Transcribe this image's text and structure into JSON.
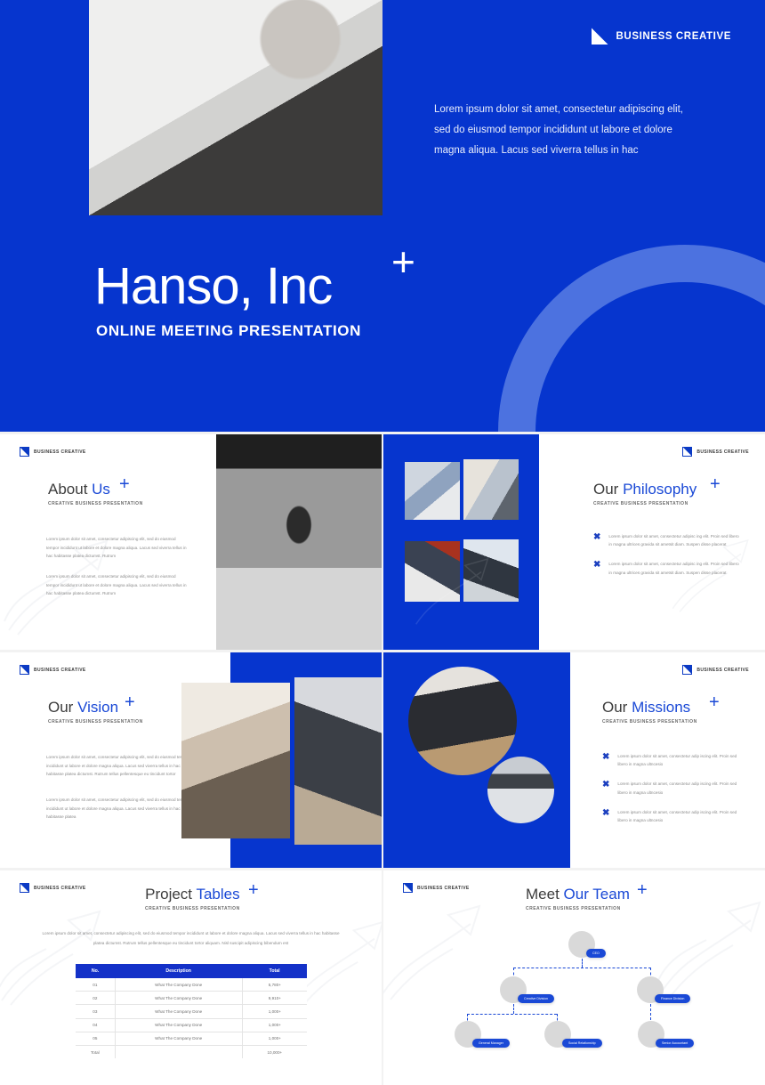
{
  "brand": {
    "name": "BUSINESS CREATIVE",
    "logo_icon": "diagonal-square-logo-icon",
    "primary_color": "#0635CE",
    "accent_color": "#1A49D6",
    "ring_color": "#4C72E0"
  },
  "hero": {
    "title": "Hanso, Inc",
    "subtitle": "ONLINE MEETING PRESENTATION",
    "paragraph": "Lorem ipsum dolor sit amet, consectetur adipiscing elit, sed do eiusmod tempor incididunt ut labore et dolore magna aliqua. Lacus sed viverra tellus in hac",
    "plus_icon": "+",
    "photo_alt": "desk-laptop-topdown-photo"
  },
  "kicker": "CREATIVE BUSINESS PRESENTATION",
  "slides": {
    "about": {
      "title_light": "About ",
      "title_bold": "Us",
      "kicker": "CREATIVE BUSINESS PRESENTATION",
      "plus_icon": "+",
      "paragraphs": [
        "Lorem ipsum dolor sit amet, consectetur adipiscing elit, sed do eiusmod tempor incididunt ut labore et dolore magna aliqua. Lacus sed viverra tellus in hac habitasse platea dictumst. Rutrum",
        "Lorem ipsum dolor sit amet, consectetur adipiscing elit, sed do eiusmod tempor incididunt ut labore et dolore magna aliqua. Lacus sed viverra tellus in hac habitasse platea dictumst. Rutrum"
      ],
      "photo_alt": "subway-station-woman-bw-photo"
    },
    "philosophy": {
      "title_light": "Our ",
      "title_bold": "Philosophy",
      "kicker": "CREATIVE BUSINESS PRESENTATION",
      "plus_icon": "+",
      "bullet_icon": "✖",
      "bullets": [
        "Lorem ipsum dolor sit amet, consectetur adipisc ing elit. Proin sed libero in magna ultrices gravida sit ametsit diam. Suspen disse placerat",
        "Lorem ipsum dolor sit amet, consectetur adipisc ing elit. Proin sed libero in magna ultrices gravida sit ametsit diam. Suspen disse placerat"
      ],
      "photos": [
        "office-window-laptop-photo",
        "hands-writing-notebook-photo",
        "businessman-presenting-photo",
        "hands-typing-chart-laptop-photo"
      ]
    },
    "vision": {
      "title_light": "Our ",
      "title_bold": "Vision",
      "kicker": "CREATIVE BUSINESS PRESENTATION",
      "plus_icon": "+",
      "paragraphs": [
        "Lorem ipsum dolor sit amet, consectetur adipiscing elit, sed do eiusmod tempor incididunt ut labore et dolore magna aliqua. Lacus sed viverra tellus in hac habitasse platea dictumst. Rutrum tellus pellentesque eu tincidunt tortor",
        "Lorem ipsum dolor sit amet, consectetur adipiscing elit, sed do eiusmod tempor incididunt ut labore et dolore magna aliqua. Lacus sed viverra tellus in hac habitasse platea"
      ],
      "photos": [
        "office-shelf-imac-photo",
        "developer-at-desk-photo"
      ]
    },
    "missions": {
      "title_light": "Our ",
      "title_bold": "Missions",
      "kicker": "CREATIVE BUSINESS PRESENTATION",
      "plus_icon": "+",
      "bullet_icon": "✖",
      "bullets": [
        "Lorem ipsum dolor sit amet, consectetur adip iscing elit. Proin sed libero in magna ultncesio",
        "Lorem ipsum dolor sit amet, consectetur adip iscing elit. Proin sed libero in magna ultncesio",
        "Lorem ipsum dolor sit amet, consectetur adip iscing elit. Proin sed libero in magna ultncesio"
      ],
      "photos": [
        "imac-workstation-circle-photo",
        "macbook-topdown-circle-photo"
      ]
    },
    "tables": {
      "title_light": "Project ",
      "title_bold": "Tables",
      "kicker": "CREATIVE BUSINESS PRESENTATION",
      "plus_icon": "+",
      "intro": "Lorem ipsum dolor sit amet, consectetur adipiscing elit, sed do eiusmod tempor incididunt ut labore et dolore magna aliqua. Lacus sed viverra tellus in hac habitasse platea dictumst. Rutrum tellus pellentesque eu tincidunt tortor aliquam. Nisl suscipit adipiscing bibendum est",
      "columns": [
        "No.",
        "Description",
        "Total"
      ],
      "rows": [
        [
          "01",
          "What The Company Done",
          "5,780+"
        ],
        [
          "02",
          "What The Company Done",
          "9,910+"
        ],
        [
          "03",
          "What The Company Done",
          "1,000+"
        ],
        [
          "04",
          "What The Company Done",
          "1,000+"
        ],
        [
          "05",
          "What The Company Done",
          "1,000+"
        ]
      ],
      "total_row": [
        "Total",
        "",
        "10,000+"
      ]
    },
    "team": {
      "title_light": "Meet ",
      "title_bold": "Our Team",
      "kicker": "CREATIVE BUSINESS PRESENTATION",
      "plus_icon": "+",
      "nodes": [
        {
          "label": "CEO",
          "avatar": "ceo-avatar"
        },
        {
          "label": "Creative Division",
          "avatar": "creative-division-avatar"
        },
        {
          "label": "Finance Division",
          "avatar": "finance-division-avatar"
        },
        {
          "label": "General Manager",
          "avatar": "general-manager-avatar"
        },
        {
          "label": "Social Relationship",
          "avatar": "social-relationship-avatar"
        },
        {
          "label": "Senior Accountant",
          "avatar": "senior-accountant-avatar"
        }
      ]
    }
  }
}
